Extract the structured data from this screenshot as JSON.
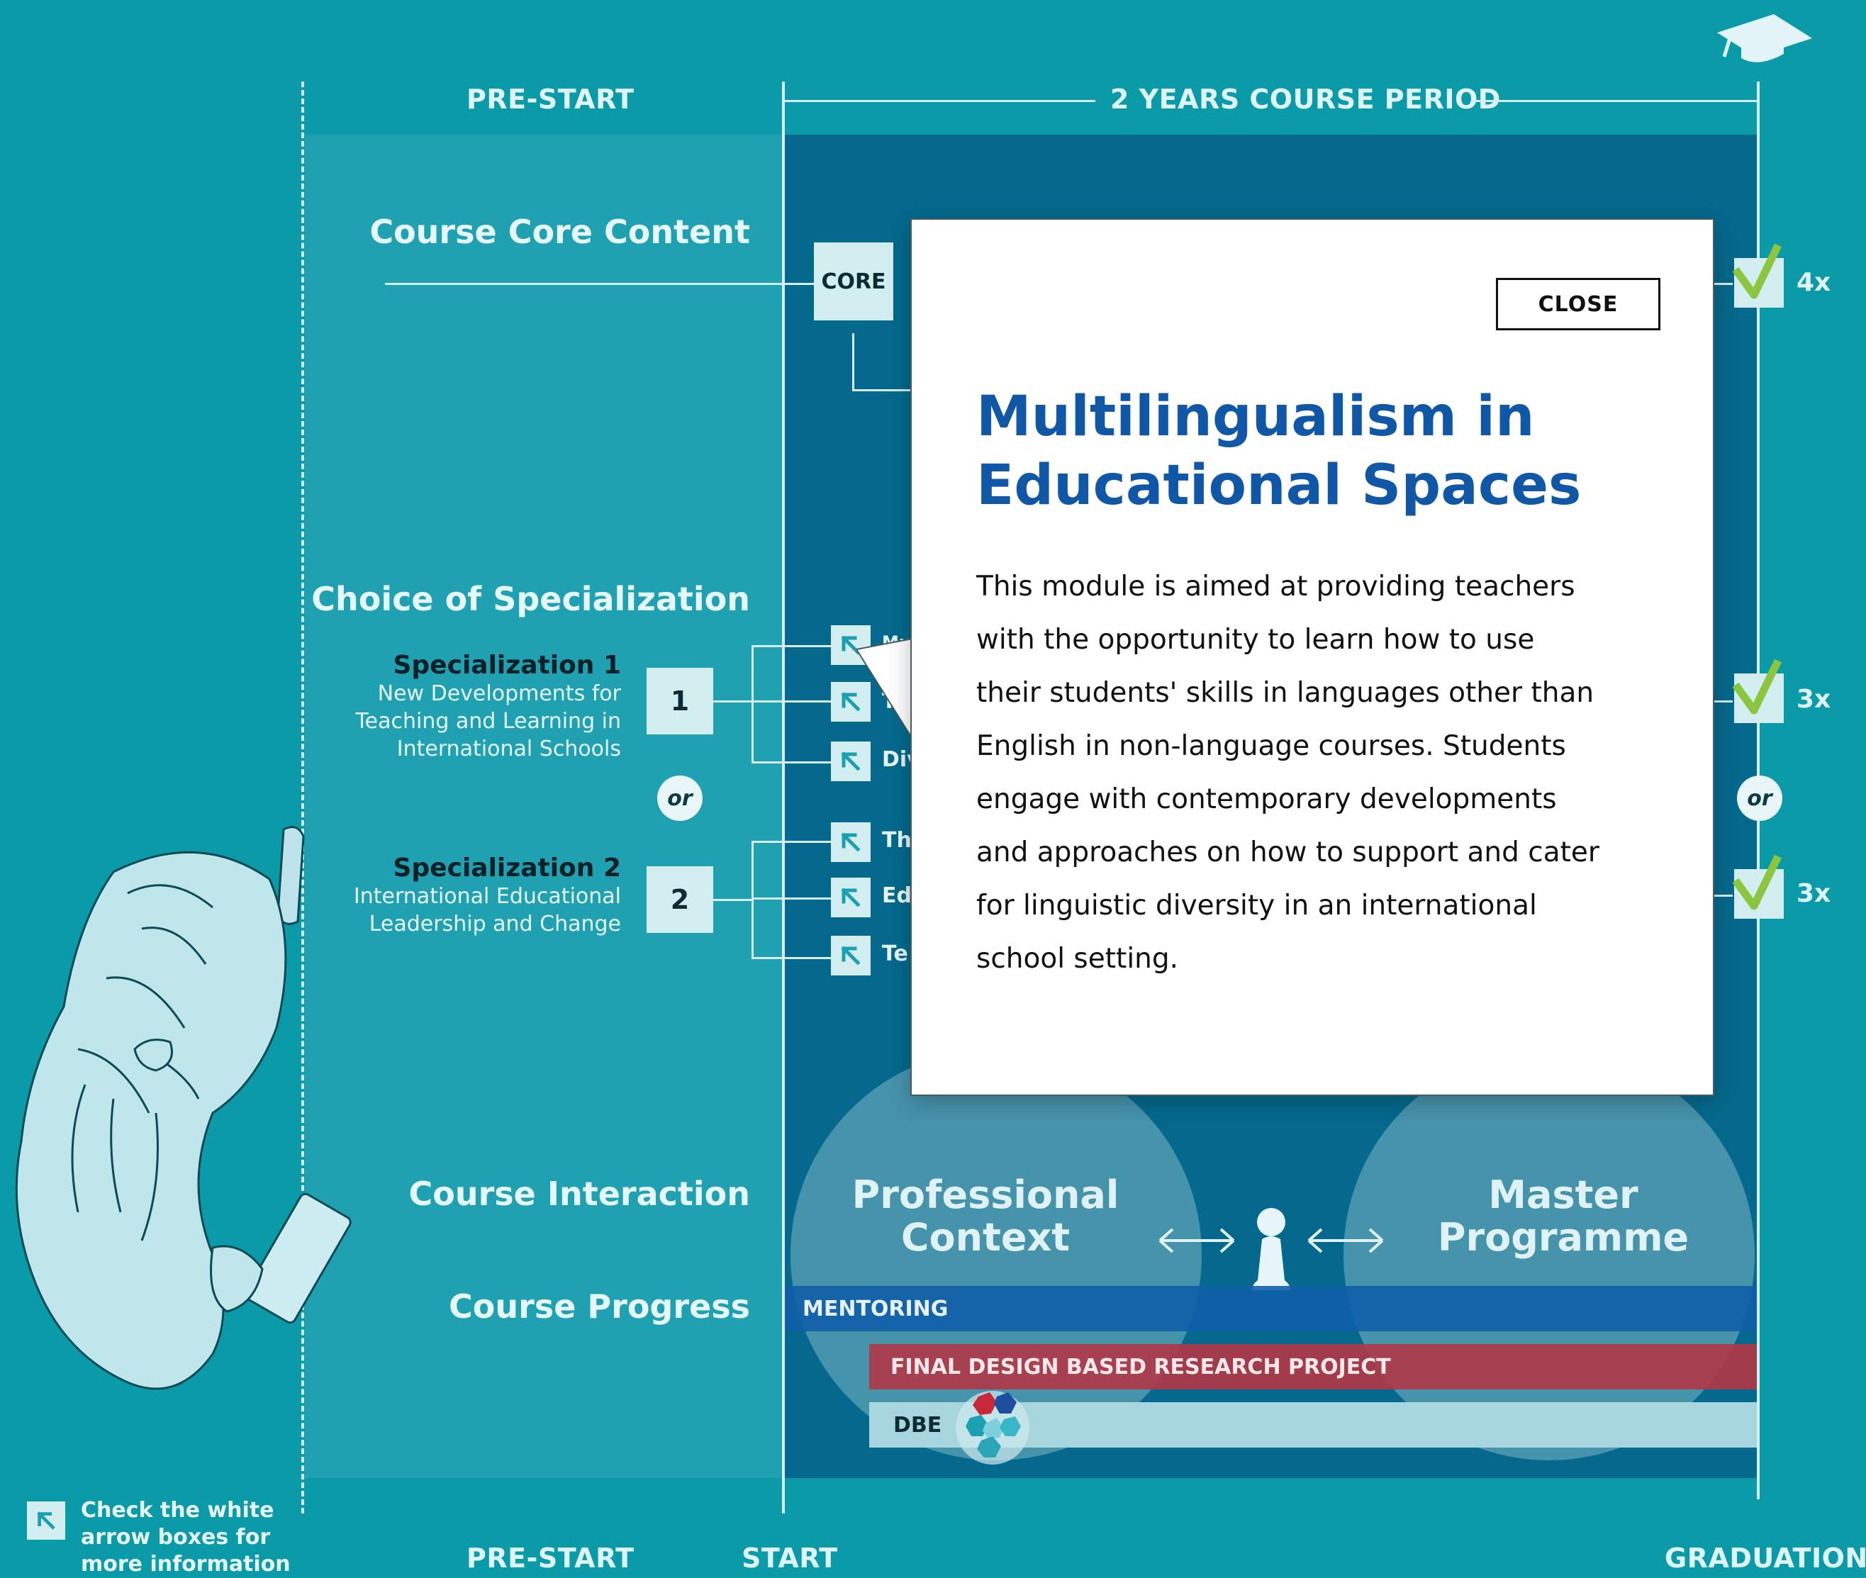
{
  "header": {
    "prestart_label": "PRE-START",
    "period_label": "2 YEARS COURSE PERIOD",
    "graduation_icon": "graduation-cap-icon"
  },
  "sections": {
    "core_content": "Course Core Content",
    "choice_specialization": "Choice of Specialization",
    "course_interaction": "Course Interaction",
    "course_progress": "Course Progress"
  },
  "core": {
    "box_label": "CORE",
    "check_count": "4x"
  },
  "specializations": [
    {
      "number": "1",
      "title": "Specialization 1",
      "desc_lines": [
        "New Developments for",
        "Teaching and Learning in",
        "International Schools"
      ],
      "module_stubs": [
        "Mu",
        "T",
        "Div"
      ],
      "check_count": "3x"
    },
    {
      "number": "2",
      "title": "Specialization 2",
      "desc_lines": [
        "International Educational",
        "Leadership and Change"
      ],
      "module_stubs": [
        "Th",
        "Ed",
        "Te"
      ],
      "check_count": "3x"
    }
  ],
  "or_label": "or",
  "interaction": {
    "left_circle_lines": [
      "Professional",
      "Context"
    ],
    "right_circle_lines": [
      "Master",
      "Programme"
    ]
  },
  "progress_bars": {
    "mentoring": "MENTORING",
    "final_project": "FINAL DESIGN BASED RESEARCH PROJECT",
    "dbe": "DBE"
  },
  "legend": {
    "lines": [
      "Check the white",
      "arrow boxes for",
      "more information"
    ]
  },
  "footer": {
    "prestart": "PRE-START",
    "start": "START",
    "graduation": "GRADUATION"
  },
  "modal": {
    "close_label": "CLOSE",
    "title_lines": [
      "Multilingualism in",
      "Educational Spaces"
    ],
    "body_lines": [
      "This module is aimed at providing teachers",
      "with the opportunity to learn how to use",
      "their students' skills in languages other than",
      "English in non-language courses. Students",
      "engage with contemporary developments",
      "and approaches on how to support and cater",
      "for linguistic diversity in an international",
      "school setting."
    ]
  },
  "colors": {
    "background": "#0a9aa8",
    "prestart_panel": "#20a1b2",
    "course_panel": "#04698c",
    "mentoring_bar": "#0f5fa8",
    "final_project_bar": "#b03848",
    "dbe_bar": "#a8d6de",
    "modal_title": "#1157a8",
    "check": "#8cc63f"
  }
}
